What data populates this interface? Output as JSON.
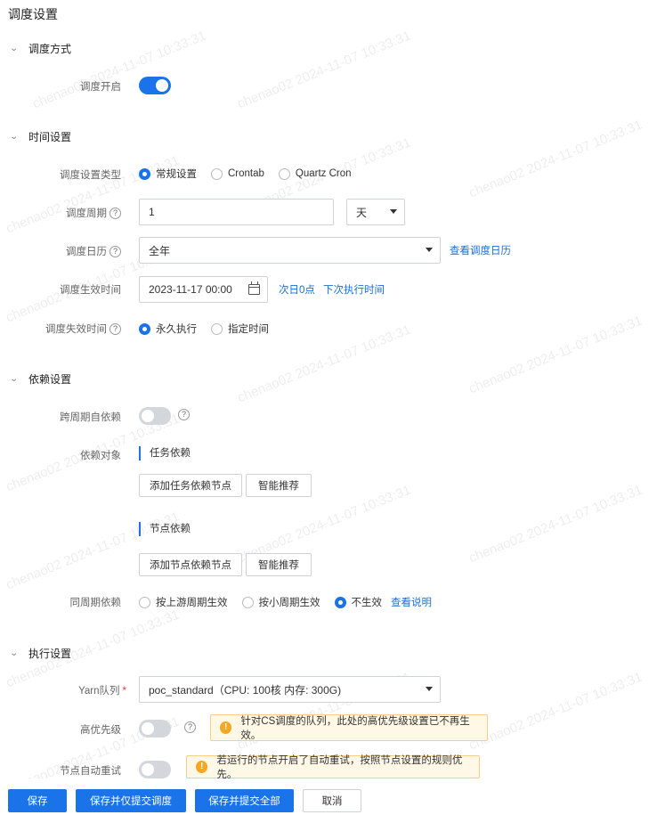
{
  "page_title": "调度设置",
  "watermark_text": "chenao02 2024-11-07 10:33:31",
  "sections": {
    "mode": {
      "title": "调度方式",
      "enable_label": "调度开启"
    },
    "time": {
      "title": "时间设置",
      "type_label": "调度设置类型",
      "type_options": [
        "常规设置",
        "Crontab",
        "Quartz Cron"
      ],
      "period_label": "调度周期",
      "period_value": "1",
      "period_unit": "天",
      "calendar_label": "调度日历",
      "calendar_value": "全年",
      "calendar_link": "查看调度日历",
      "effective_label": "调度生效时间",
      "effective_value": "2023-11-17 00:00",
      "effective_link1": "次日0点",
      "effective_link2": "下次执行时间",
      "expire_label": "调度失效时间",
      "expire_options": [
        "永久执行",
        "指定时间"
      ]
    },
    "dependency": {
      "title": "依赖设置",
      "cross_label": "跨周期自依赖",
      "target_label": "依赖对象",
      "task_dep_title": "任务依赖",
      "add_task_btn": "添加任务依赖节点",
      "smart_btn": "智能推荐",
      "node_dep_title": "节点依赖",
      "add_node_btn": "添加节点依赖节点",
      "same_period_label": "同周期依赖",
      "same_period_options": [
        "按上游周期生效",
        "按小周期生效",
        "不生效"
      ],
      "same_period_link": "查看说明"
    },
    "exec": {
      "title": "执行设置",
      "yarn_label": "Yarn队列",
      "yarn_required": "*",
      "yarn_value": "poc_standard（CPU: 100核 内存: 300G)",
      "priority_label": "高优先级",
      "priority_warning": "针对CS调度的队列，此处的高优先级设置已不再生效。",
      "retry_label": "节点自动重试",
      "retry_warning": "若运行的节点开启了自动重试，按照节点设置的规则优先。"
    }
  },
  "footer": {
    "save": "保存",
    "save_submit_schedule": "保存并仅提交调度",
    "save_submit_all": "保存并提交全部",
    "cancel": "取消"
  },
  "colors": {
    "primary": "#1a73e8",
    "link": "#1a6fd8",
    "warn_bg": "#fff8e6"
  }
}
